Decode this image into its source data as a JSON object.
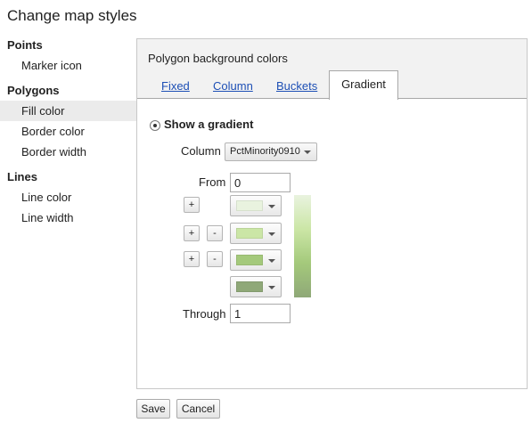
{
  "dialog": {
    "title": "Change map styles"
  },
  "sidebar": {
    "sections": [
      {
        "heading": "Points",
        "items": [
          "Marker icon"
        ]
      },
      {
        "heading": "Polygons",
        "items": [
          "Fill color",
          "Border color",
          "Border width"
        ]
      },
      {
        "heading": "Lines",
        "items": [
          "Line color",
          "Line width"
        ]
      }
    ],
    "active_item": "Fill color"
  },
  "panel": {
    "label": "Polygon background colors",
    "tabs": [
      "Fixed",
      "Column",
      "Buckets",
      "Gradient"
    ],
    "active_tab": "Gradient",
    "show_gradient_label": "Show a gradient",
    "column_label": "Column",
    "column_value": "PctMinority0910",
    "from_label": "From",
    "from_value": "0",
    "through_label": "Through",
    "through_value": "1",
    "plus_label": "+",
    "minus_label": "-",
    "gradient_colors": [
      "#e9f3df",
      "#cbe6a6",
      "#a4c97b",
      "#8fa878"
    ]
  },
  "footer": {
    "save_label": "Save",
    "cancel_label": "Cancel"
  },
  "icons": {
    "radio": "radio-selected-icon",
    "dropdown": "chevron-down-icon"
  }
}
